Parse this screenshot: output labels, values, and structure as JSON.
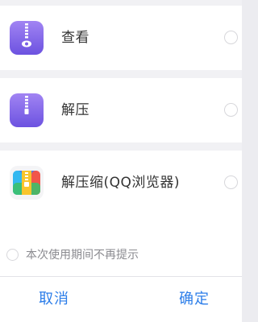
{
  "options": [
    {
      "label": "查看",
      "icon": "zip-view-icon",
      "selected": false
    },
    {
      "label": "解压",
      "icon": "zip-extract-icon",
      "selected": false
    },
    {
      "label": "解压缩(QQ浏览器)",
      "icon": "qq-browser-zip-icon",
      "selected": false
    }
  ],
  "remember": {
    "label": "本次使用期间不再提示",
    "checked": false
  },
  "buttons": {
    "cancel": "取消",
    "confirm": "确定"
  },
  "colors": {
    "accent": "#2b7de9",
    "icon_purple_top": "#9b7cf0",
    "icon_purple_bottom": "#6f56e3"
  }
}
